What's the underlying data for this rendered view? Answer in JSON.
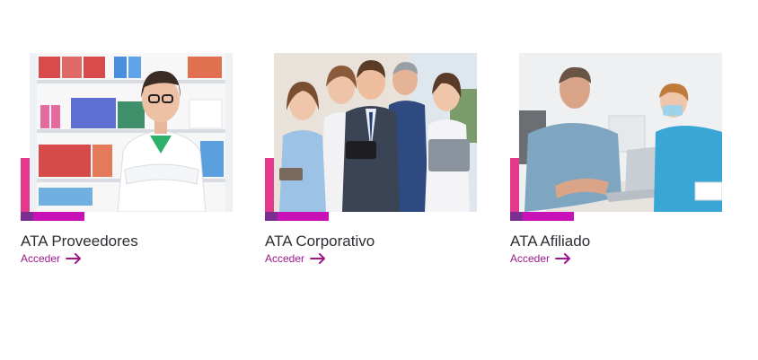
{
  "theme": {
    "accent": "#c812b8",
    "accent_pink": "#e4398a",
    "accent_purple": "#7b2f93",
    "link": "#a0188c",
    "title": "#2d2d33"
  },
  "cards": [
    {
      "title": "ATA Proveedores",
      "link_label": "Acceder",
      "link_icon": "arrow-right-icon",
      "image": "pharmacist-photo"
    },
    {
      "title": "ATA Corporativo",
      "link_label": "Acceder",
      "link_icon": "arrow-right-icon",
      "image": "business-team-photo"
    },
    {
      "title": "ATA Afiliado",
      "link_label": "Acceder",
      "link_icon": "arrow-right-icon",
      "image": "patient-consultation-photo"
    }
  ]
}
